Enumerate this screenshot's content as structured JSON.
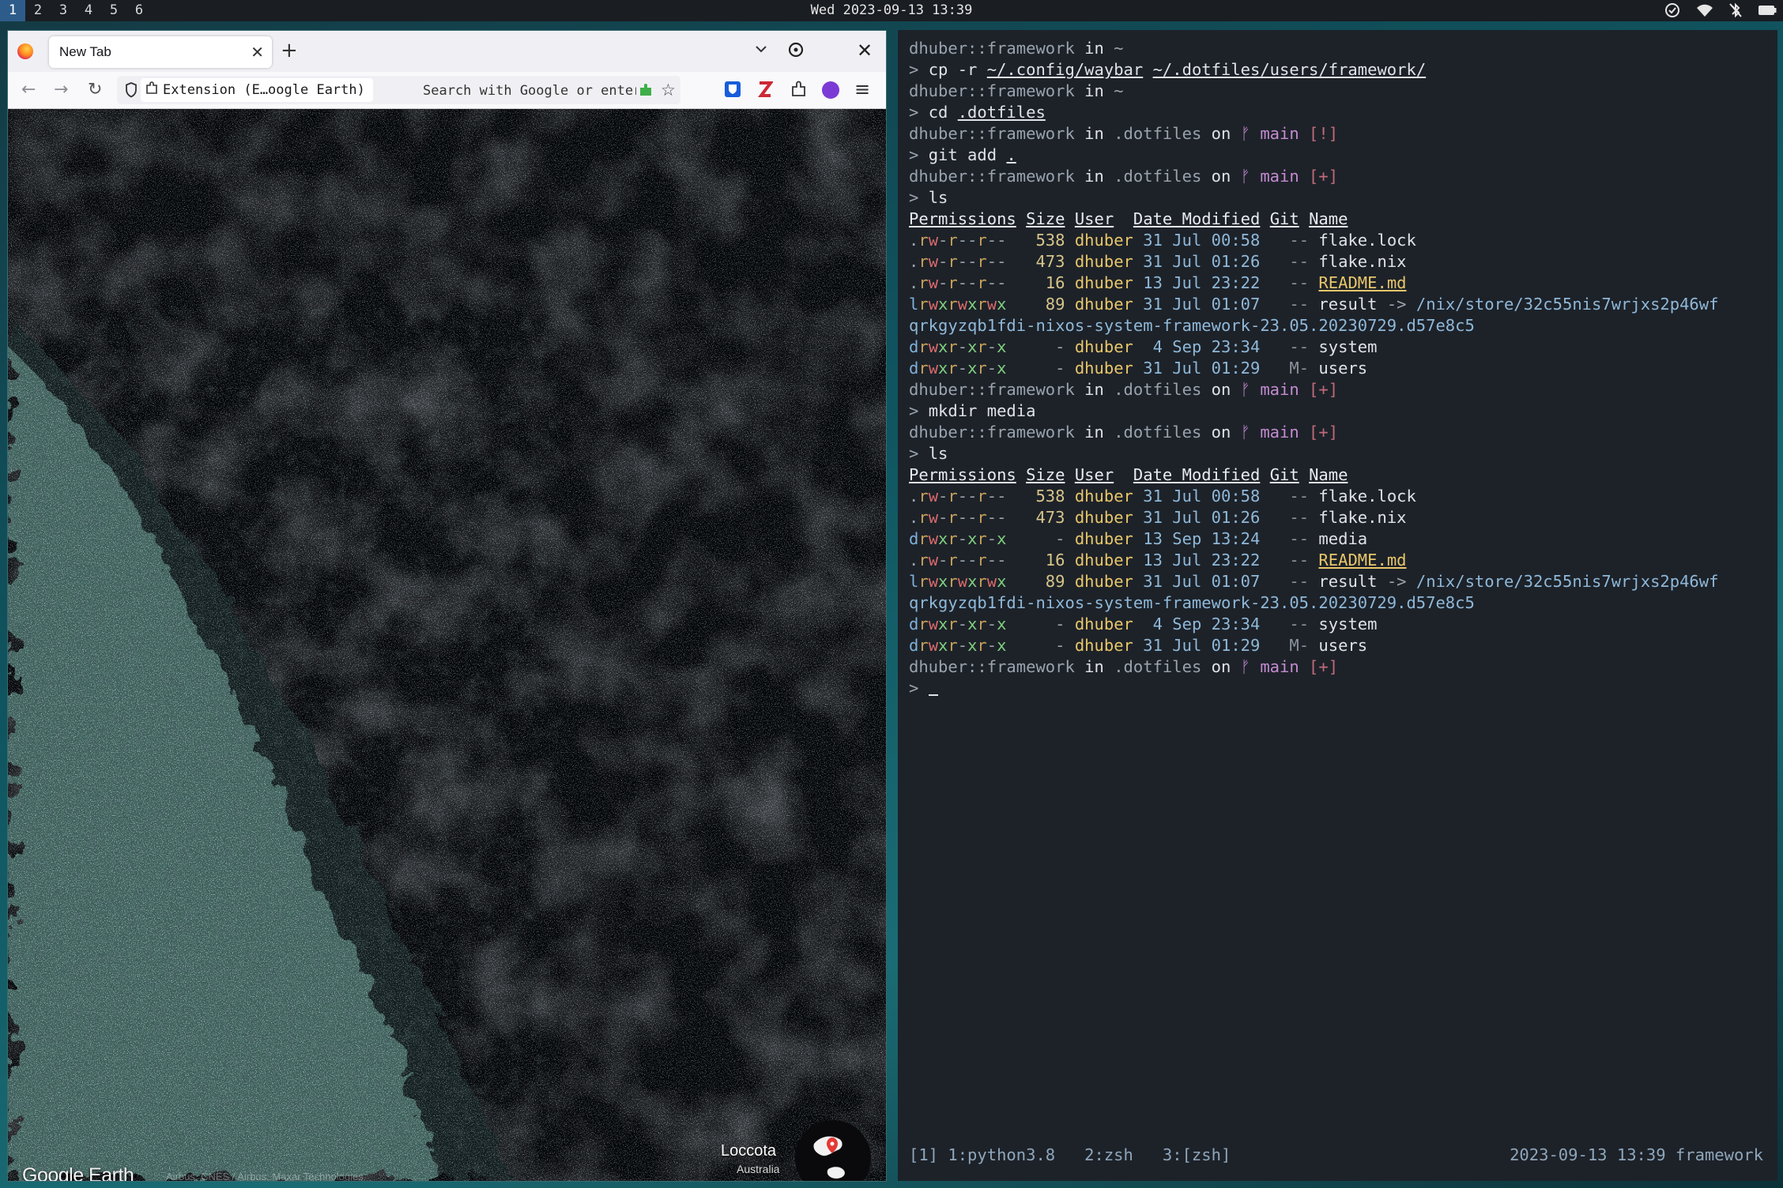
{
  "topbar": {
    "workspaces": [
      "1",
      "2",
      "3",
      "4",
      "5",
      "6"
    ],
    "active_workspace": "1",
    "clock": "Wed 2023-09-13 13:39",
    "tray_icons": [
      "check-circle-icon",
      "wifi-icon",
      "bluetooth-off-icon",
      "battery-icon"
    ]
  },
  "browser": {
    "tab_title": "New Tab",
    "tab_close": "✕",
    "new_tab": "+",
    "close": "✕",
    "nav": {
      "back": "←",
      "forward": "→",
      "reload": "↻",
      "menu": "≡",
      "star": "☆"
    },
    "identity_label": "Extension (E…oogle Earth)",
    "url_placeholder": "Search with Google or enter address",
    "page": {
      "place_name": "Loccota",
      "place_country": "Australia",
      "brand": "Google Earth",
      "credits": "Airbus, CNES / Airbus, Maxar Technologies"
    },
    "colors": {
      "shallow_water": "#8fd6cf",
      "deep_water": "#0d1218",
      "profile": "#7b3ad6"
    }
  },
  "terminal": {
    "lines": [
      {
        "type": "prompt",
        "user": "dhuber::framework",
        "in": " in ",
        "dir": "~",
        "git": null
      },
      {
        "type": "cmd",
        "parts": [
          {
            "t": "cp -r "
          },
          {
            "t": "~/.config/waybar",
            "u": true
          },
          {
            "t": " "
          },
          {
            "t": "~/.dotfiles/users/framework/",
            "u": true
          }
        ]
      },
      {
        "type": "prompt",
        "user": "dhuber::framework",
        "in": " in ",
        "dir": "~",
        "git": null
      },
      {
        "type": "cmd",
        "parts": [
          {
            "t": "cd "
          },
          {
            "t": ".dotfiles",
            "u": true
          }
        ]
      },
      {
        "type": "prompt",
        "user": "dhuber::framework",
        "in": " in ",
        "dir": ".dotfiles",
        "on": " on ",
        "branch_icon": "ᚠ",
        "branch": " main ",
        "status": "[!]"
      },
      {
        "type": "cmd",
        "parts": [
          {
            "t": "git add "
          },
          {
            "t": ".",
            "u": true
          }
        ]
      },
      {
        "type": "prompt",
        "user": "dhuber::framework",
        "in": " in ",
        "dir": ".dotfiles",
        "on": " on ",
        "branch_icon": "ᚠ",
        "branch": " main ",
        "status": "[+]"
      },
      {
        "type": "cmd",
        "parts": [
          {
            "t": "ls"
          }
        ]
      },
      {
        "type": "header",
        "cols": [
          "Permissions",
          "Size",
          "User",
          "Date Modified",
          "Git",
          "Name"
        ]
      },
      {
        "type": "entry",
        "perm": ".rw-r--r--",
        "size": "538",
        "user": "dhuber",
        "date": "31 Jul 00:58",
        "git": "--",
        "name": "flake.lock"
      },
      {
        "type": "entry",
        "perm": ".rw-r--r--",
        "size": "473",
        "user": "dhuber",
        "date": "31 Jul 01:26",
        "git": "--",
        "name": "flake.nix"
      },
      {
        "type": "entry",
        "perm": ".rw-r--r--",
        "size": "16",
        "user": "dhuber",
        "date": "13 Jul 23:22",
        "git": "--",
        "name": "README.md",
        "link": true
      },
      {
        "type": "entry",
        "perm": "lrwxrwxrwx",
        "size": "89",
        "user": "dhuber",
        "date": "31 Jul 01:07",
        "git": "--",
        "name": "result",
        "arrow": " -> ",
        "target": "/nix/store/32c55nis7wrjxs2p46wf"
      },
      {
        "type": "wrap",
        "text": "qrkgyzqb1fdi-nixos-system-framework-23.05.20230729.d57e8c5"
      },
      {
        "type": "entry",
        "perm": "drwxr-xr-x",
        "size": "-",
        "user": "dhuber",
        "date": " 4 Sep 23:34",
        "git": "--",
        "name": "system"
      },
      {
        "type": "entry",
        "perm": "drwxr-xr-x",
        "size": "-",
        "user": "dhuber",
        "date": "31 Jul 01:29",
        "git": "M-",
        "name": "users"
      },
      {
        "type": "prompt",
        "user": "dhuber::framework",
        "in": " in ",
        "dir": ".dotfiles",
        "on": " on ",
        "branch_icon": "ᚠ",
        "branch": " main ",
        "status": "[+]"
      },
      {
        "type": "cmd",
        "parts": [
          {
            "t": "mkdir media"
          }
        ]
      },
      {
        "type": "prompt",
        "user": "dhuber::framework",
        "in": " in ",
        "dir": ".dotfiles",
        "on": " on ",
        "branch_icon": "ᚠ",
        "branch": " main ",
        "status": "[+]"
      },
      {
        "type": "cmd",
        "parts": [
          {
            "t": "ls"
          }
        ]
      },
      {
        "type": "header",
        "cols": [
          "Permissions",
          "Size",
          "User",
          "Date Modified",
          "Git",
          "Name"
        ]
      },
      {
        "type": "entry",
        "perm": ".rw-r--r--",
        "size": "538",
        "user": "dhuber",
        "date": "31 Jul 00:58",
        "git": "--",
        "name": "flake.lock"
      },
      {
        "type": "entry",
        "perm": ".rw-r--r--",
        "size": "473",
        "user": "dhuber",
        "date": "31 Jul 01:26",
        "git": "--",
        "name": "flake.nix"
      },
      {
        "type": "entry",
        "perm": "drwxr-xr-x",
        "size": "-",
        "user": "dhuber",
        "date": "13 Sep 13:24",
        "git": "--",
        "name": "media"
      },
      {
        "type": "entry",
        "perm": ".rw-r--r--",
        "size": "16",
        "user": "dhuber",
        "date": "13 Jul 23:22",
        "git": "--",
        "name": "README.md",
        "link": true
      },
      {
        "type": "entry",
        "perm": "lrwxrwxrwx",
        "size": "89",
        "user": "dhuber",
        "date": "31 Jul 01:07",
        "git": "--",
        "name": "result",
        "arrow": " -> ",
        "target": "/nix/store/32c55nis7wrjxs2p46wf"
      },
      {
        "type": "wrap",
        "text": "qrkgyzqb1fdi-nixos-system-framework-23.05.20230729.d57e8c5"
      },
      {
        "type": "entry",
        "perm": "drwxr-xr-x",
        "size": "-",
        "user": "dhuber",
        "date": " 4 Sep 23:34",
        "git": "--",
        "name": "system"
      },
      {
        "type": "entry",
        "perm": "drwxr-xr-x",
        "size": "-",
        "user": "dhuber",
        "date": "31 Jul 01:29",
        "git": "M-",
        "name": "users"
      },
      {
        "type": "prompt",
        "user": "dhuber::framework",
        "in": " in ",
        "dir": ".dotfiles",
        "on": " on ",
        "branch_icon": "ᚠ",
        "branch": " main ",
        "status": "[+]"
      },
      {
        "type": "input",
        "prompt": "> "
      }
    ],
    "prompt_char": "> ",
    "status": {
      "windows": "[1] 1:python3.8   2:zsh   3:[zsh]",
      "right": "2023-09-13 13:39 framework"
    }
  }
}
